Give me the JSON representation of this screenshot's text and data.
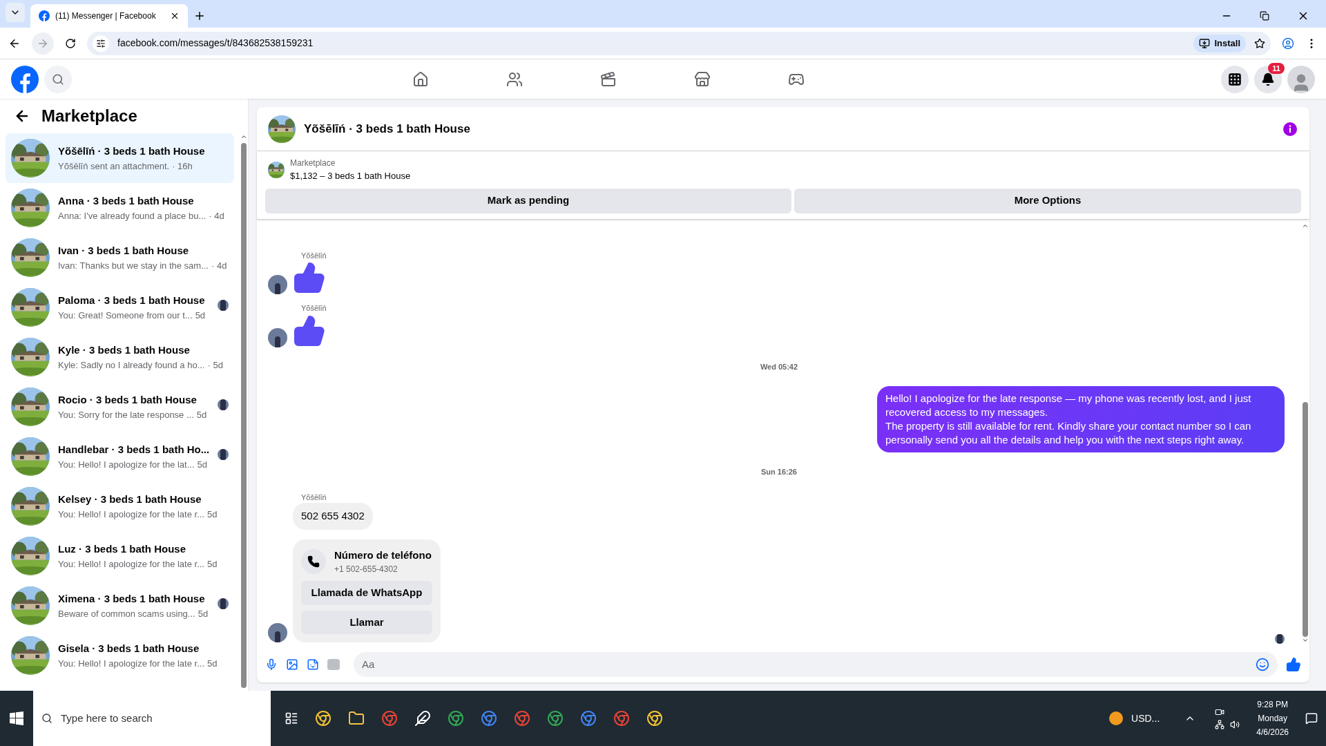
{
  "browser": {
    "tab_title": "(11) Messenger | Facebook",
    "url": "facebook.com/messages/t/843682538159231",
    "install_label": "Install"
  },
  "top_nav": {
    "notification_count": "11"
  },
  "sidebar": {
    "title": "Marketplace",
    "conversations": [
      {
        "title": "Yõšēlīń · 3 beds 1 bath House",
        "preview": "Yõšēlīń sent an attachment.",
        "time": "· 16h",
        "selected": true,
        "seen": false
      },
      {
        "title": "Anna · 3 beds 1 bath House",
        "preview": "Anna: I've already found a place bu...",
        "time": "· 4d",
        "selected": false,
        "seen": false
      },
      {
        "title": "Ivan · 3 beds 1 bath House",
        "preview": "Ivan: Thanks but we stay in the sam...",
        "time": "· 4d",
        "selected": false,
        "seen": false
      },
      {
        "title": "Paloma · 3 beds 1 bath House",
        "preview": "You: Great! Someone from our t...",
        "time": "5d",
        "selected": false,
        "seen": true
      },
      {
        "title": "Kyle · 3 beds 1 bath House",
        "preview": "Kyle: Sadly no I already found a ho...",
        "time": "· 5d",
        "selected": false,
        "seen": false
      },
      {
        "title": "Rocio · 3 beds 1 bath House",
        "preview": "You: Sorry for the late response ...",
        "time": "5d",
        "selected": false,
        "seen": true
      },
      {
        "title": "Handlebar · 3 beds 1 bath Ho...",
        "preview": "You: Hello! I apologize for the lat...",
        "time": "5d",
        "selected": false,
        "seen": true
      },
      {
        "title": "Kelsey · 3 beds 1 bath House",
        "preview": "You: Hello! I apologize for the late r...",
        "time": "5d",
        "selected": false,
        "seen": false
      },
      {
        "title": "Luz · 3 beds 1 bath House",
        "preview": "You: Hello! I apologize for the late r...",
        "time": "5d",
        "selected": false,
        "seen": false
      },
      {
        "title": "Ximena · 3 beds 1 bath House",
        "preview": "Beware of common scams using...",
        "time": "5d",
        "selected": false,
        "seen": true
      },
      {
        "title": "Gisela · 3 beds 1 bath House",
        "preview": "You: Hello! I apologize for the late r...",
        "time": "5d",
        "selected": false,
        "seen": false
      }
    ]
  },
  "chat": {
    "title": "Yõšēlīń · 3 beds 1 bath House",
    "listing": {
      "label": "Marketplace",
      "title": "$1,132 – 3 beds 1 bath House"
    },
    "actions": [
      "Mark as pending",
      "More Options"
    ],
    "messages": [
      {
        "kind": "like",
        "sender": "Yõšēlīń",
        "avatar": true
      },
      {
        "kind": "like",
        "sender": "Yõšēlīń",
        "avatar": true
      },
      {
        "kind": "timestamp",
        "text": "Wed 05:42"
      },
      {
        "kind": "outgoing",
        "lines": [
          "Hello! I apologize for the late response — my phone was recently lost, and I just recovered access to my messages.",
          "The property is still available for rent. Kindly share your contact number so I can personally send you all the details and help you with the next steps right away."
        ]
      },
      {
        "kind": "timestamp",
        "text": "Sun 16:26"
      },
      {
        "kind": "incoming",
        "sender": "Yõšēlīń",
        "text": "502 655 4302",
        "avatar": false
      },
      {
        "kind": "contact",
        "title": "Número de teléfono",
        "number": "+1 502-655-4302",
        "buttons": [
          "Llamada de WhatsApp",
          "Llamar"
        ],
        "avatar": true
      }
    ],
    "composer": {
      "placeholder": "Aa"
    }
  },
  "taskbar": {
    "search_placeholder": "Type here to search",
    "tray_label": "USD...",
    "time": "9:28 PM",
    "day": "Monday",
    "date": "4/6/2026"
  }
}
